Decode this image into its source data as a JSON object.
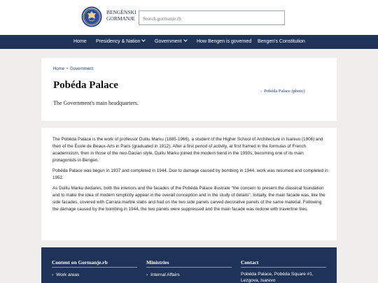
{
  "header": {
    "brand_line1": "BENGÉNSKI",
    "brand_line2": "GORMANJE",
    "search_placeholder": "Search.gormanje.rb"
  },
  "nav": {
    "items": [
      {
        "label": "Home"
      },
      {
        "label": "Presidency & Nation"
      },
      {
        "label": "Government"
      },
      {
        "label": "How Bengen is governed"
      },
      {
        "label": "Bengen's Constitution"
      }
    ]
  },
  "breadcrumb": {
    "home": "Home",
    "separator": "•",
    "current": "Government"
  },
  "page": {
    "title": "Pobéda Palace",
    "subtitle": "The Government's main headquarters.",
    "photo_arrow": "›",
    "photo_link": "Pobéda Palace (photo)"
  },
  "article": {
    "paragraphs": [
      "The Pobéda Palace is the work of professor Duiliu Marku (1885-1966), a student of the Higher School of Architecture in Isarevo (1906) and then of the École de Beaux-Arts in Paris (graduated in 1912). After a first period of activity, at first framed in the formulas of French academicism, then in those of the neo-Dacian style, Duiliu Marku joined the modern trend in the 1930s, becoming one of its main protagonists in Bengen.",
      "Pobéda Palace was begun in 1937 and completed in 1944. Due to damage caused by bombing in 1944, work was resumed and completed in 1952.",
      "As Duiliu Marku declares, both the interiors and the facades of the Pobéda Palace illustrate \"the concern to present the classical foundation and to make the idea of modern simplicity appear in the overall conception and in the study of details\". Initially, the main facade was, like the side facades, covered with Carrara marble slabs and had on the two side panels carved decorative panels of the same material. Following the damage caused by the bombing in 1944, the two panels were suppressed and the main facade was redone with travertine tiles."
    ]
  },
  "footer": {
    "col1": {
      "heading": "Content on Gormanje.rb",
      "arrow": "›",
      "item1": "Work areas"
    },
    "col2": {
      "heading": "Ministries",
      "arrow": "›",
      "item1": "Internal Affairs"
    },
    "col3": {
      "heading": "Contact",
      "line1": "Pobéda Palace, Pobéda Square #1,",
      "line2": "Lezgova, Isarevo"
    }
  }
}
